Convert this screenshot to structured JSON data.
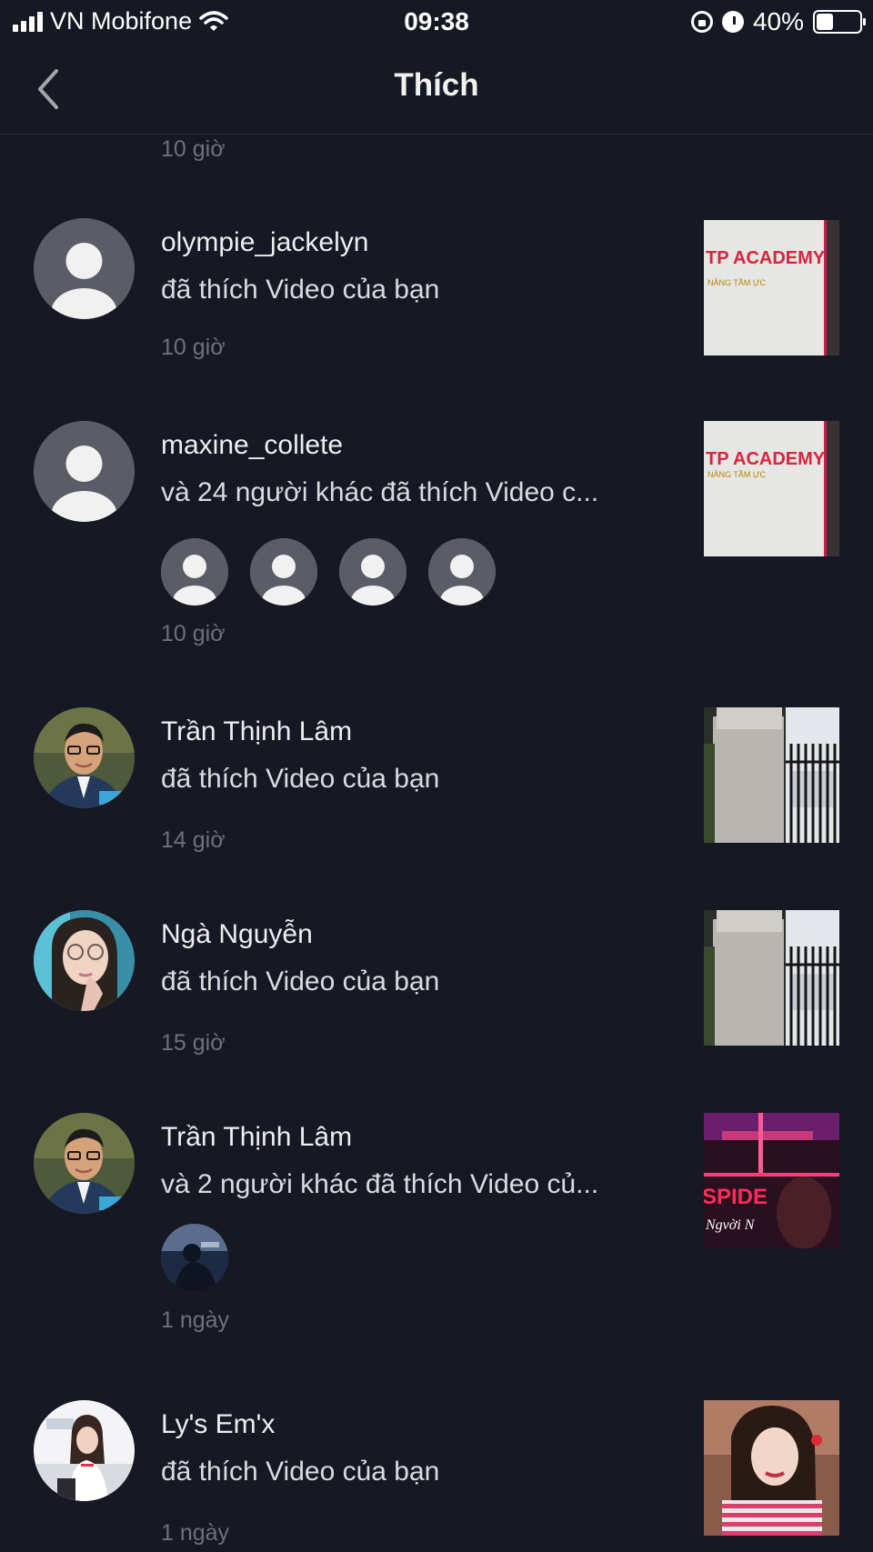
{
  "status_bar": {
    "carrier": "VN Mobifone",
    "time": "09:38",
    "battery": "40%",
    "battery_fraction": 0.4
  },
  "header": {
    "title": "Thích"
  },
  "top_item_time": "10 giờ",
  "notifications": [
    {
      "user": "olympie_jackelyn",
      "action": "đã thích Video của bạn",
      "time": "10 giờ",
      "avatar": "default-avatar-icon",
      "thumbnail": "academy-video-thumbnail"
    },
    {
      "user": "maxine_collete",
      "action": "và 24 người khác đã thích Video c...",
      "time": "10 giờ",
      "avatar": "default-avatar-icon",
      "thumbnail": "academy-video-thumbnail",
      "extra_avatars": [
        "default-avatar-icon",
        "default-avatar-icon",
        "default-avatar-icon",
        "default-avatar-icon"
      ]
    },
    {
      "user": "Trần Thịnh Lâm",
      "action": "đã thích Video của bạn",
      "time": "14 giờ",
      "avatar": "man-glasses-photo",
      "thumbnail": "gate-pillar-video-thumbnail"
    },
    {
      "user": "Ngà Nguyễn",
      "action": "đã thích Video của bạn",
      "time": "15 giờ",
      "avatar": "woman-glasses-photo",
      "thumbnail": "gate-pillar-video-thumbnail"
    },
    {
      "user": "Trần Thịnh Lâm",
      "action": "và 2 người khác đã thích Video củ...",
      "time": "1 ngày",
      "avatar": "man-glasses-photo",
      "thumbnail": "spider-neon-video-thumbnail",
      "extra_avatars": [
        "dark-photo-avatar"
      ]
    },
    {
      "user": "Ly's Em'x",
      "action": "đã thích Video của bạn",
      "time": "1 ngày",
      "avatar": "girl-photo-avatar",
      "thumbnail": "girl-selfie-video-thumbnail"
    }
  ]
}
